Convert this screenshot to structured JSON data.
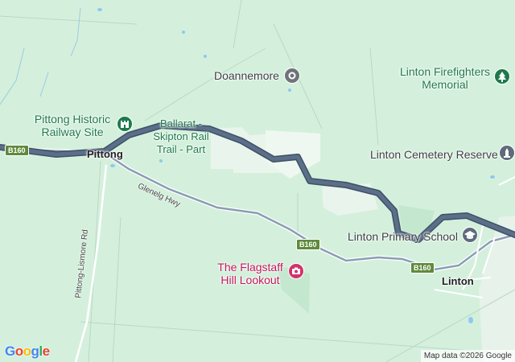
{
  "map": {
    "labels": {
      "doannemore": "Doannemore",
      "linton_firefighters_memorial_line1": "Linton Firefighters",
      "linton_firefighters_memorial_line2": "Memorial",
      "pittong_historic_railway_site_line1": "Pittong Historic",
      "pittong_historic_railway_site_line2": "Railway Site",
      "ballarat_skipton_rail_trail_line1": "Ballarat -",
      "ballarat_skipton_rail_trail_line2": "Skipton Rail",
      "ballarat_skipton_rail_trail_line3": "Trail - Part",
      "pittong": "Pittong",
      "linton_cemetery_reserve": "Linton Cemetery Reserve",
      "linton_primary_school": "Linton Primary School",
      "flagstaff_hill_lookout_line1": "The Flagstaff",
      "flagstaff_hill_lookout_line2": "Hill Lookout",
      "linton": "Linton",
      "glenelg_hwy": "Glenelg Hwy",
      "pittong_lismore_rd": "Pittong-Lismore Rd"
    },
    "route_shields": {
      "b160_west": "B160",
      "b160_mid": "B160",
      "b160_east": "B160"
    },
    "icons": {
      "doannemore": "place-pin-icon",
      "linton_firefighters_memorial": "tree-icon",
      "pittong_historic_railway_site": "castle-icon",
      "linton_cemetery_reserve": "monument-icon",
      "linton_primary_school": "school-icon",
      "flagstaff_hill_lookout": "camera-icon"
    },
    "colors": {
      "land": "#d4f0dc",
      "route": "#5b6f88",
      "route_outline": "#3f5068",
      "highway": "#8a9db3",
      "shield": "#5f8a3c",
      "park_text": "#1e7a4c",
      "lookout_text": "#c2185b"
    }
  },
  "branding": {
    "logo_text": "Google",
    "attribution": "Map data ©2026 Google"
  }
}
